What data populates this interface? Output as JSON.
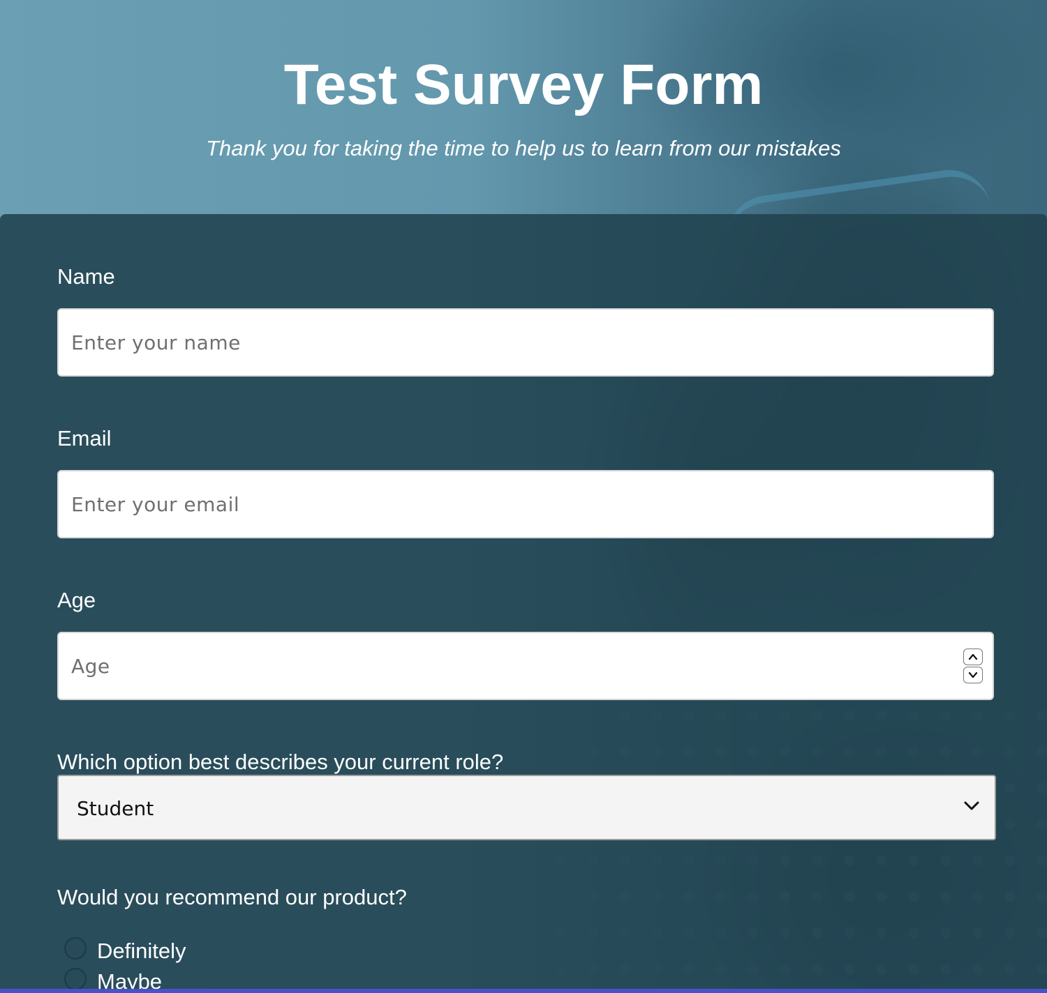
{
  "header": {
    "title": "Test Survey Form",
    "subtitle": "Thank you for taking the time to help us to learn from our mistakes"
  },
  "form": {
    "name": {
      "label": "Name",
      "placeholder": "Enter your name"
    },
    "email": {
      "label": "Email",
      "placeholder": "Enter your email"
    },
    "age": {
      "label": "Age",
      "placeholder": "Age"
    },
    "role": {
      "label": "Which option best describes your current role?",
      "selected": "Student"
    },
    "recommend": {
      "label": "Would you recommend our product?",
      "options": [
        "Definitely",
        "Maybe"
      ]
    }
  },
  "colors": {
    "panel": "#21424e",
    "accent_bar": "#4a52c8"
  }
}
